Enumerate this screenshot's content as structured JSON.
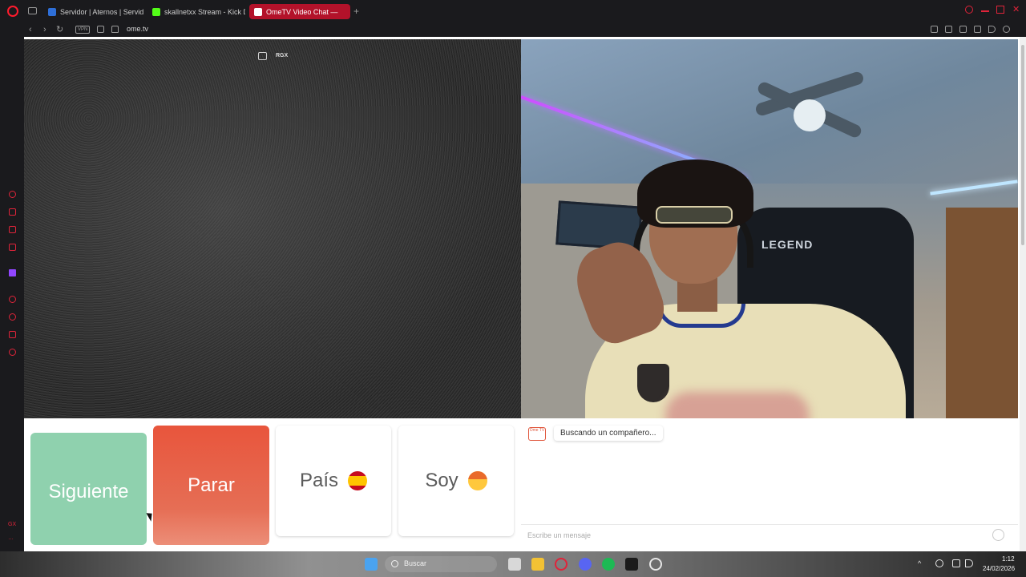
{
  "browser": {
    "tabs": [
      {
        "title": "Servidor | Aternos | Servid",
        "favicon": "aternos-icon",
        "active": false
      },
      {
        "title": "skallnetxx Stream - Kick D",
        "favicon": "kick-icon",
        "active": false
      },
      {
        "title": "OmeTV Video Chat —",
        "favicon": "ometv-icon",
        "active": true
      }
    ],
    "new_tab_glyph": "+",
    "vpn_label": "VPN",
    "url": "ome.tv"
  },
  "sidebar": {
    "bottom_label": "GX",
    "more_glyph": "…"
  },
  "stranger_video": {
    "overlay_label": "RGX"
  },
  "controls": {
    "next_label": "Siguiente",
    "stop_label": "Parar",
    "country_label": "País",
    "gender_label": "Soy"
  },
  "chat": {
    "logo_text": "Ome TV",
    "status_message": "Buscando un compañero...",
    "input_placeholder": "Escribe un mensaje"
  },
  "taskbar": {
    "search_label": "Buscar",
    "time": "1:12",
    "date": "24/02/2026"
  },
  "colors": {
    "accent": "#e0243a",
    "next_button": "#8fd1ae",
    "stop_button": "#e8553c"
  }
}
